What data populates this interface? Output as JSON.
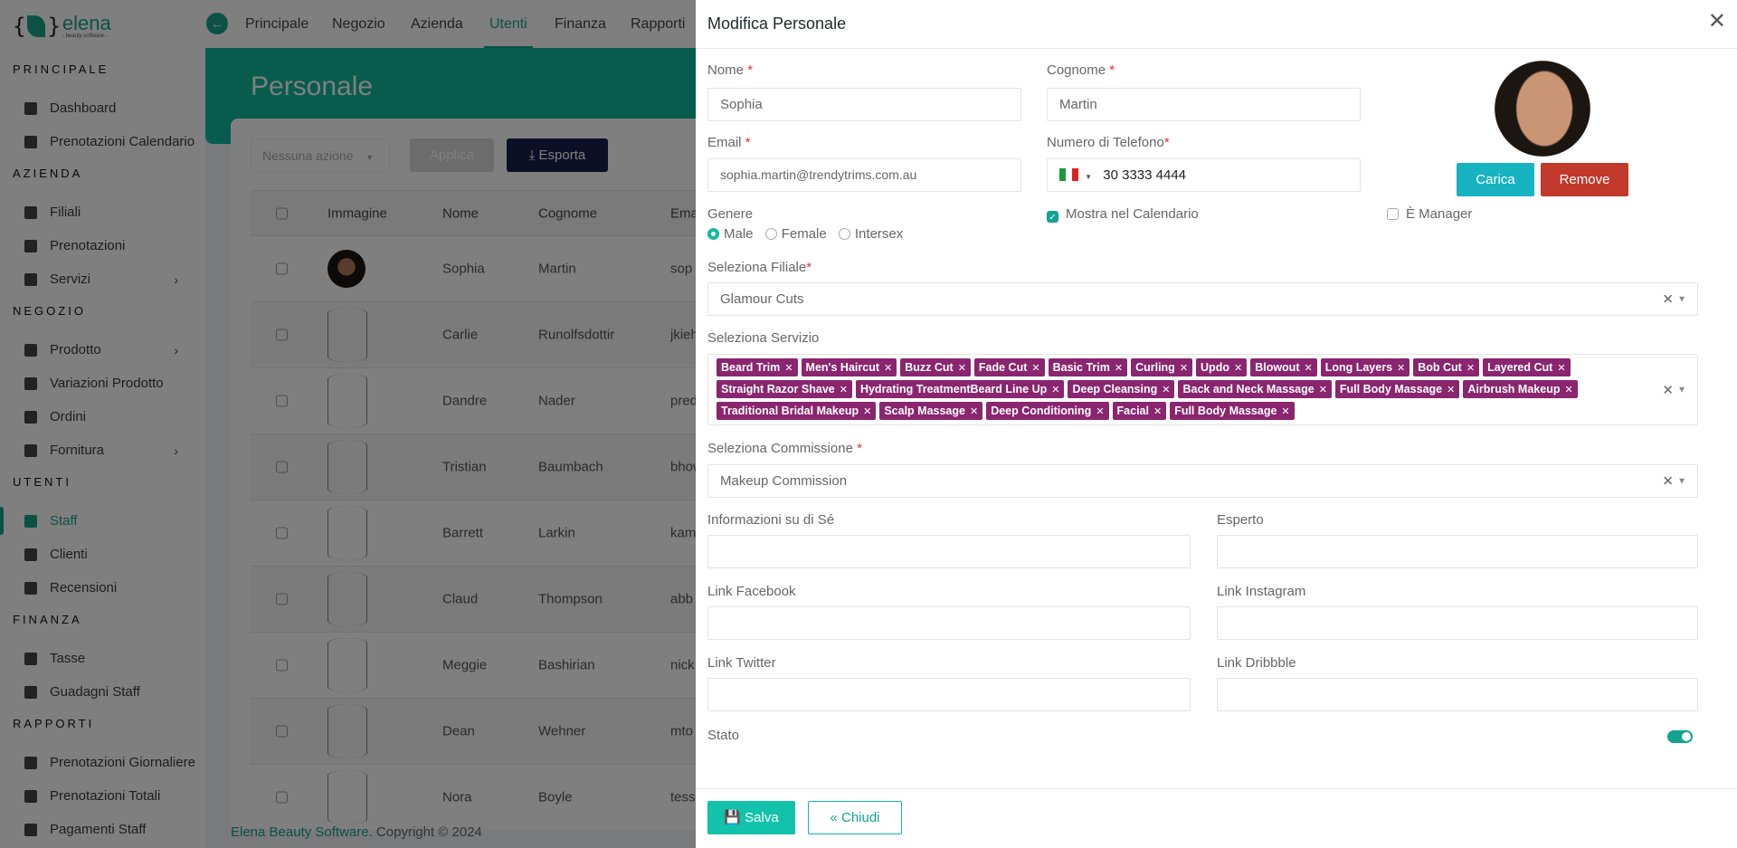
{
  "app": {
    "logo_name": "elena",
    "logo_tagline": "- beauty software -"
  },
  "topnav": {
    "items": [
      "Principale",
      "Negozio",
      "Azienda",
      "Utenti",
      "Finanza",
      "Rapporti"
    ],
    "active": "Utenti"
  },
  "sidebar": {
    "sections": [
      {
        "title": "PRINCIPALE",
        "items": [
          {
            "label": "Dashboard",
            "icon": "dashboard-icon"
          },
          {
            "label": "Prenotazioni Calendario",
            "icon": "calendar-icon"
          }
        ]
      },
      {
        "title": "AZIENDA",
        "items": [
          {
            "label": "Filiali",
            "icon": "branch-icon"
          },
          {
            "label": "Prenotazioni",
            "icon": "calendar-icon"
          },
          {
            "label": "Servizi",
            "icon": "services-icon",
            "chevron": true
          }
        ]
      },
      {
        "title": "NEGOZIO",
        "items": [
          {
            "label": "Prodotto",
            "icon": "store-icon",
            "chevron": true
          },
          {
            "label": "Variazioni Prodotto",
            "icon": "variations-icon"
          },
          {
            "label": "Ordini",
            "icon": "bag-icon"
          },
          {
            "label": "Fornitura",
            "icon": "truck-icon",
            "chevron": true
          }
        ]
      },
      {
        "title": "UTENTI",
        "items": [
          {
            "label": "Staff",
            "icon": "id-card-icon",
            "active": true
          },
          {
            "label": "Clienti",
            "icon": "users-icon"
          },
          {
            "label": "Recensioni",
            "icon": "star-icon"
          }
        ]
      },
      {
        "title": "FINANZA",
        "items": [
          {
            "label": "Tasse",
            "icon": "tax-icon"
          },
          {
            "label": "Guadagni Staff",
            "icon": "money-icon"
          }
        ]
      },
      {
        "title": "RAPPORTI",
        "items": [
          {
            "label": "Prenotazioni Giornaliere",
            "icon": "file-invoice-icon"
          },
          {
            "label": "Prenotazioni Totali",
            "icon": "chart-line-icon"
          },
          {
            "label": "Pagamenti Staff",
            "icon": "list-icon"
          }
        ]
      }
    ]
  },
  "page": {
    "title": "Personale",
    "bulk_action_placeholder": "Nessuna azione",
    "apply_label": "Applica",
    "export_label": "Esporta",
    "columns": [
      "Immagine",
      "Nome",
      "Cognome",
      "Email"
    ],
    "rows": [
      {
        "nome": "Sophia",
        "cognome": "Martin",
        "email": "sop",
        "has_photo": true
      },
      {
        "nome": "Carlie",
        "cognome": "Runolfsdottir",
        "email": "jkieh"
      },
      {
        "nome": "Dandre",
        "cognome": "Nader",
        "email": "pred"
      },
      {
        "nome": "Tristian",
        "cognome": "Baumbach",
        "email": "bhow"
      },
      {
        "nome": "Barrett",
        "cognome": "Larkin",
        "email": "kam"
      },
      {
        "nome": "Claud",
        "cognome": "Thompson",
        "email": "abb"
      },
      {
        "nome": "Meggie",
        "cognome": "Bashirian",
        "email": "nick"
      },
      {
        "nome": "Dean",
        "cognome": "Wehner",
        "email": "mto"
      },
      {
        "nome": "Nora",
        "cognome": "Boyle",
        "email": "tess"
      }
    ]
  },
  "footer": {
    "brand": "Elena Beauty Software",
    "copyright": ". Copyright © 2024"
  },
  "modal": {
    "title": "Modifica Personale",
    "nome_label": "Nome",
    "nome": "Sophia",
    "cognome_label": "Cognome",
    "cognome": "Martin",
    "email_label": "Email",
    "email": "sophia.martin@trendytrims.com.au",
    "phone_label": "Numero di Telefono",
    "phone": "30 3333 4444",
    "phone_country": "IT",
    "upload_label": "Carica",
    "remove_label": "Remove",
    "gender_label": "Genere",
    "genders": [
      "Male",
      "Female",
      "Intersex"
    ],
    "gender_selected": "Male",
    "show_calendar_label": "Mostra nel Calendario",
    "show_calendar": true,
    "manager_label": "È Manager",
    "manager": false,
    "branch_label": "Seleziona Filiale",
    "branch": "Glamour Cuts",
    "services_label": "Seleziona Servizio",
    "services": [
      "Beard Trim",
      "Men's Haircut",
      "Buzz Cut",
      "Fade Cut",
      "Basic Trim",
      "Curling",
      "Updo",
      "Blowout",
      "Long Layers",
      "Bob Cut",
      "Layered Cut",
      "Straight Razor Shave",
      "Hydrating TreatmentBeard Line Up",
      "Deep Cleansing",
      "Back and Neck Massage",
      "Full Body Massage",
      "Airbrush Makeup",
      "Traditional Bridal Makeup",
      "Scalp Massage",
      "Deep Conditioning",
      "Facial",
      "Full Body Massage"
    ],
    "commission_label": "Seleziona Commissione",
    "commission": "Makeup Commission",
    "about_label": "Informazioni su di Sé",
    "expert_label": "Esperto",
    "facebook_label": "Link Facebook",
    "instagram_label": "Link Instagram",
    "twitter_label": "Link Twitter",
    "dribbble_label": "Link Dribbble",
    "status_label": "Stato",
    "status": true,
    "save_label": "Salva",
    "close_label": "Chiudi",
    "tag_color": "#8a2570",
    "accent": "#12b9a2"
  }
}
